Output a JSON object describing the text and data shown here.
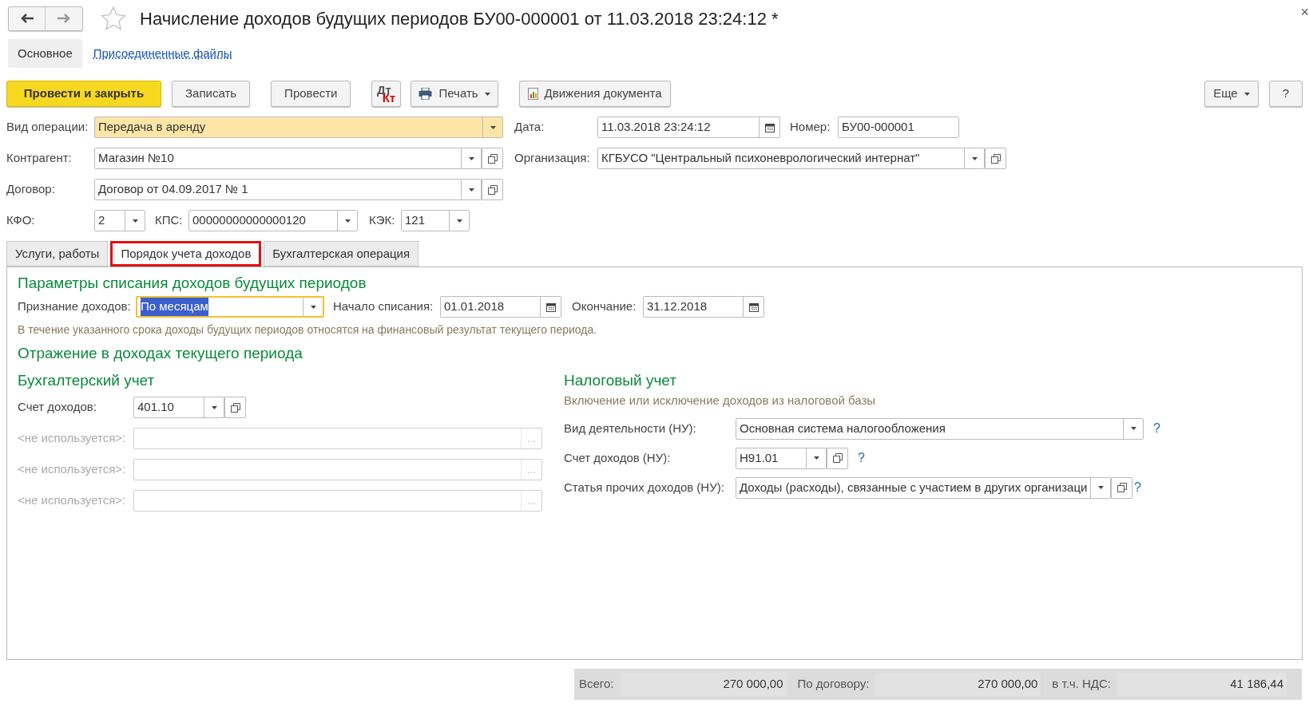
{
  "window": {
    "title": "Начисление доходов будущих периодов БУ00-000001 от 11.03.2018 23:24:12 *",
    "favorite": false,
    "close": "×"
  },
  "form_tabs": [
    {
      "label": "Основное",
      "selected": true
    },
    {
      "label": "Присоединенные файлы",
      "selected": false
    }
  ],
  "toolbar": {
    "left": [
      {
        "kind": "primary",
        "label": "Провести и закрыть"
      },
      {
        "kind": "plain",
        "label": "Записать"
      },
      {
        "kind": "plain",
        "label": "Провести"
      },
      {
        "kind": "dtkt",
        "label": "Дт",
        "label_2": "Кт"
      },
      {
        "kind": "print",
        "label": "Печать"
      },
      {
        "kind": "report",
        "label": "Движения документа"
      }
    ],
    "right": [
      {
        "kind": "menu",
        "label": "Еще"
      },
      {
        "kind": "plain",
        "label": "?"
      }
    ]
  },
  "header": {
    "operation": {
      "label": "Вид операции:",
      "value": "Передача в аренду",
      "highlighted": true
    },
    "date": {
      "label": "Дата:",
      "value": "11.03.2018 23:24:12"
    },
    "number": {
      "label": "Номер:",
      "value": "БУ00-000001"
    },
    "counterparty": {
      "label": "Контрагент:",
      "value": "Магазин №10"
    },
    "organization": {
      "label": "Организация:",
      "value": "КГБУСО \"Центральный психоневрологический интернат\""
    },
    "contract": {
      "label": "Договор:",
      "value": "Договор от 04.09.2017 № 1"
    },
    "kfo": {
      "label": "КФО:",
      "value": "2"
    },
    "kps": {
      "label": "КПС:",
      "value": "00000000000000120"
    },
    "kek": {
      "label": "КЭК:",
      "value": "121"
    }
  },
  "tabs": [
    {
      "label": "Услуги, работы",
      "selected": false,
      "annotated": false
    },
    {
      "label": "Порядок учета доходов",
      "selected": true,
      "annotated": true
    },
    {
      "label": "Бухгалтерская операция",
      "selected": false,
      "annotated": false
    }
  ],
  "panel": {
    "section_title": "Параметры списания доходов будущих периодов",
    "recognition": {
      "label": "Признание доходов:",
      "value": "По месяцам",
      "focused": true,
      "text_selected": true
    },
    "start": {
      "label": "Начало списания:",
      "value": "01.01.2018"
    },
    "end": {
      "label": "Окончание:",
      "value": "31.12.2018"
    },
    "note": "В течение указанного срока доходы будущих периодов относятся на финансовый результат текущего периода.",
    "section_title_2": "Отражение в доходах текущего периода",
    "accounting": {
      "title": "Бухгалтерский учет",
      "account": {
        "label": "Счет доходов:",
        "value": "401.10"
      },
      "subconto": [
        {
          "label": "<не используется>:",
          "button": "...",
          "disabled": true
        },
        {
          "label": "<не используется>:",
          "button": "...",
          "disabled": true
        },
        {
          "label": "<не используется>:",
          "button": "...",
          "disabled": true
        }
      ]
    },
    "tax": {
      "title": "Налоговый учет",
      "note": "Включение или исключение доходов из налоговой базы",
      "rows": [
        {
          "kind": "select",
          "label": "Вид деятельности (НУ):",
          "value": "Основная система налогообложения",
          "help": "?"
        },
        {
          "kind": "account",
          "label": "Счет доходов (НУ):",
          "value": "Н91.01",
          "help": "?"
        },
        {
          "kind": "article",
          "label": "Статья прочих доходов (НУ):",
          "value": "Доходы (расходы), связанные с участием в других организаци",
          "help": "?"
        }
      ]
    }
  },
  "totals": [
    {
      "label": "Всего:",
      "value": "270 000,00"
    },
    {
      "label": "По договору:",
      "value": "270 000,00"
    },
    {
      "label": "в т.ч. НДС:",
      "value": "41 186,44"
    }
  ]
}
